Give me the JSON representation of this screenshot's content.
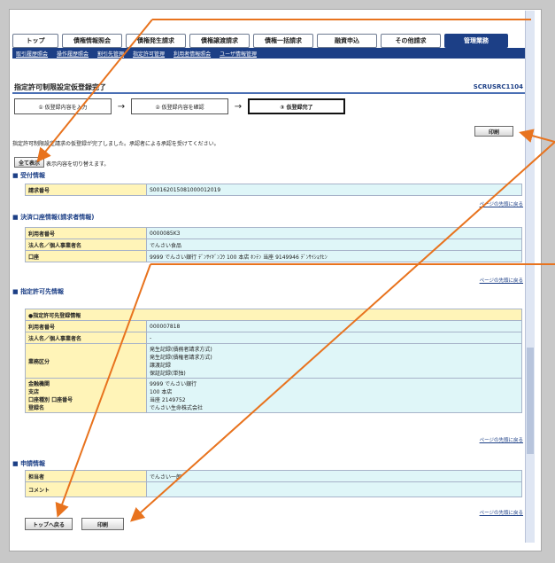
{
  "tabs": [
    {
      "label": "トップ"
    },
    {
      "label": "債権情報照会"
    },
    {
      "label": "債権発生請求"
    },
    {
      "label": "債権譲渡請求"
    },
    {
      "label": "債権一括請求"
    },
    {
      "label": "融資申込"
    },
    {
      "label": "その他請求"
    },
    {
      "label": "管理業務"
    }
  ],
  "subnav": [
    "取引履歴照会",
    "操作履歴照会",
    "割引先管理",
    "指定許可管理",
    "利用者情報照会",
    "ユーザ情報管理"
  ],
  "page": {
    "title": "指定許可制限設定仮登録完了",
    "screen_id": "SCRUSRC1104"
  },
  "steps": [
    "① 仮登録内容を入力",
    "② 仮登録内容を確認",
    "③ 仮登録完了"
  ],
  "buttons": {
    "print": "印刷",
    "show_all": "全て表示",
    "back_to_top": "トップへ戻る",
    "print_bottom": "印刷"
  },
  "message": "指定許可制限設定請求の仮登録が完了しました。承認者による承認を受けてください。",
  "show_all_note": "表示内容を切り替えます。",
  "page_top_link": "ページの先頭に戻る",
  "sections": {
    "receipt": {
      "title": "受付情報",
      "rows": [
        {
          "label": "請求番号",
          "value": "S00162015081000012019"
        }
      ]
    },
    "account": {
      "title": "決済口座情報(請求者情報)",
      "rows": [
        {
          "label": "利用者番号",
          "value": "0000085K3"
        },
        {
          "label": "法人名／個人事業者名",
          "value": "でんさい食品"
        },
        {
          "label": "口座",
          "value": "9999 でんさい銀行 ﾃﾞﾝｻｲｷﾞﾝｺｳ 100 本店 ﾎﾝﾃﾝ 当座 9149946 ﾃﾞﾝｻｲｼｮｸﾋﾝ"
        }
      ]
    },
    "permit": {
      "title": "指定許可先情報",
      "subheader": "●指定許可先登録情報",
      "rows": [
        {
          "label": "利用者番号",
          "value": "000007818"
        },
        {
          "label": "法人名／個人事業者名",
          "value": "-"
        },
        {
          "label": "業務区分",
          "value": "発生記録(債務者請求方式)\n発生記録(債権者請求方式)\n譲渡記録\n保証記録(単独)"
        },
        {
          "label": "金融機関\n支店\n口座種別 口座番号\n登録名",
          "value": "9999 でんさい銀行\n100 本店\n当座 2149752\nでんさい生命株式会社"
        }
      ]
    },
    "applicant": {
      "title": "申請情報",
      "rows": [
        {
          "label": "担当者",
          "value": "でんさい一郎"
        },
        {
          "label": "コメント",
          "value": ""
        }
      ]
    }
  },
  "accent_colors": {
    "nav": "#1c3f86",
    "annotation": "#e8731e",
    "row_label": "#fff4b8",
    "row_value": "#dff6f8"
  }
}
